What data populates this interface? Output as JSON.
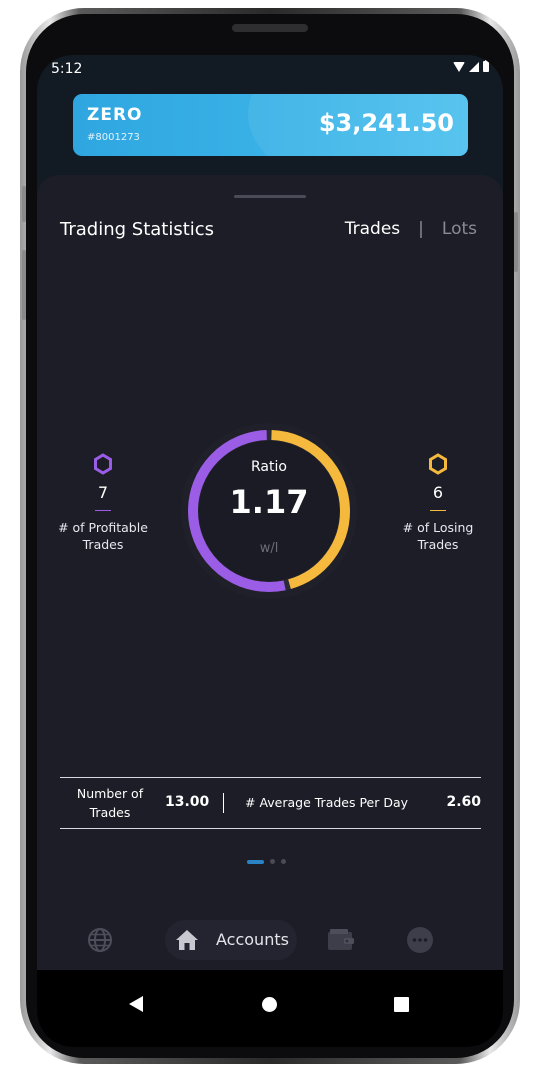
{
  "status_bar": {
    "time": "5:12",
    "icons": [
      "wifi-icon",
      "signal-icon",
      "battery-icon"
    ]
  },
  "account": {
    "name": "ZERO",
    "number": "#8001273",
    "balance": "$3,241.50",
    "card_color": "#3bb4e8"
  },
  "stats": {
    "title": "Trading Statistics",
    "toggle": {
      "active": "Trades",
      "inactive": "Lots",
      "separator": "|"
    },
    "profitable": {
      "value": "7",
      "label_line1": "# of Profitable",
      "label_line2": "Trades",
      "color": "#9b5de5",
      "icon": "hexagon-icon"
    },
    "losing": {
      "value": "6",
      "label_line1": "# of Losing",
      "label_line2": "Trades",
      "color": "#f5b93e",
      "icon": "hexagon-icon"
    },
    "ratio": {
      "label": "Ratio",
      "value": "1.17",
      "unit": "w/l",
      "profitable_fraction": 0.5385
    }
  },
  "summary": {
    "trades_label_line1": "Number of",
    "trades_label_line2": "Trades",
    "trades_value": "13.00",
    "avg_label": "# Average Trades Per Day",
    "avg_value": "2.60"
  },
  "pagination": {
    "pages": 3,
    "active_index": 0
  },
  "bottom_nav": {
    "items": [
      {
        "icon": "globe-icon"
      },
      {
        "icon": "home-icon",
        "label": "Accounts",
        "active": true
      },
      {
        "icon": "wallet-icon"
      },
      {
        "icon": "more-icon"
      }
    ]
  },
  "colors": {
    "background": "#121b24",
    "sheet": "#1c1d27",
    "accent": "#2a83c4"
  }
}
